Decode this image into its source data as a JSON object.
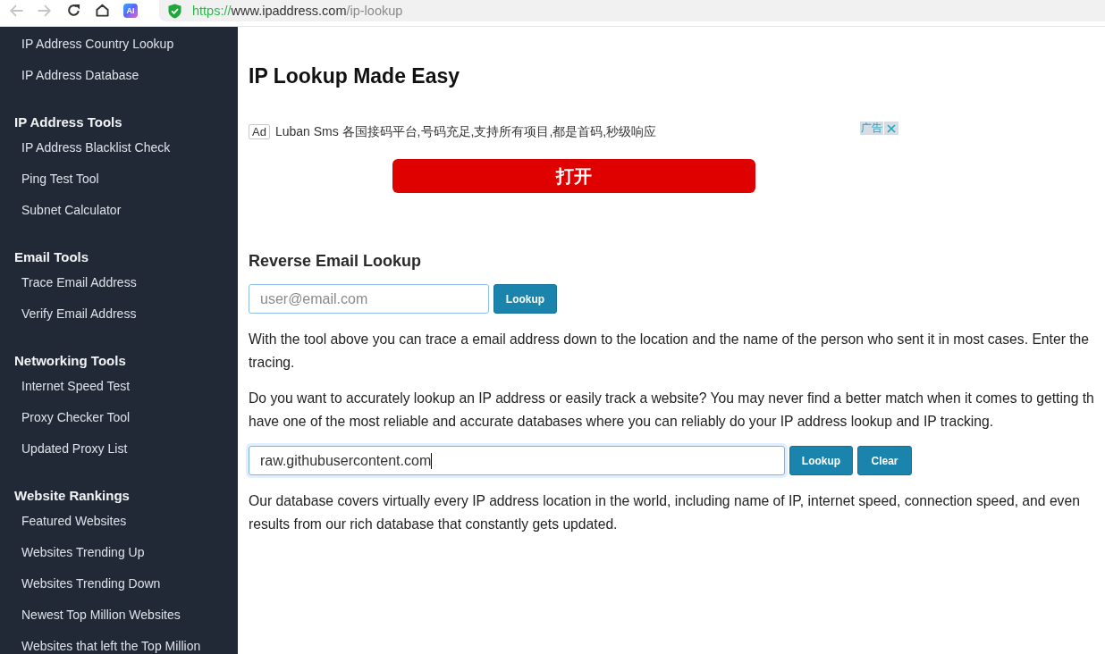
{
  "browser": {
    "nav_buttons": [
      {
        "kind": "back",
        "disabled": true
      },
      {
        "kind": "forward",
        "disabled": true
      },
      {
        "kind": "reload",
        "disabled": false
      },
      {
        "kind": "home",
        "disabled": false
      }
    ],
    "extension": {
      "label": "AI"
    },
    "address_bar": {
      "scheme": "https://",
      "host": "www.ipaddress.com",
      "path": "/ip-lookup"
    }
  },
  "sidebar": {
    "sections": [
      {
        "items": [
          "IP Address Country Lookup",
          "IP Address Database"
        ]
      },
      {
        "heading": "IP Address Tools",
        "items": [
          "IP Address Blacklist Check",
          "Ping Test Tool",
          "Subnet Calculator"
        ]
      },
      {
        "heading": "Email Tools",
        "items": [
          "Trace Email Address",
          "Verify Email Address"
        ]
      },
      {
        "heading": "Networking Tools",
        "items": [
          "Internet Speed Test",
          "Proxy Checker Tool",
          "Updated Proxy List"
        ]
      },
      {
        "heading": "Website Rankings",
        "items": [
          "Featured Websites",
          "Websites Trending Up",
          "Websites Trending Down",
          "Newest Top Million Websites",
          "Websites that left the Top Million"
        ]
      }
    ]
  },
  "main": {
    "title": "IP Lookup Made Easy",
    "ad": {
      "badge": "Ad",
      "text": "Luban Sms 各国接码平台,号码充足,支持所有项目,都是首码,秒级响应",
      "label": "广告",
      "button": "打开"
    },
    "email_lookup": {
      "heading": "Reverse Email Lookup",
      "input": {
        "placeholder": "user@email.com"
      },
      "button": "Lookup"
    },
    "description_paragraphs": [
      {
        "lines": [
          "With the tool above you can trace a email address down to the location and the name of the person who sent it in most cases. Enter the",
          "tracing."
        ]
      },
      {
        "lines": [
          "Do you want to accurately lookup an IP address or easily track a website? You may never find a better match when it comes to getting th",
          "have one of the most reliable and accurate databases where you can reliably do your IP address lookup and IP tracking."
        ]
      }
    ],
    "ip_lookup": {
      "input": {
        "value": "raw.githubusercontent.com",
        "focused": true
      },
      "buttons": [
        "Lookup",
        "Clear"
      ]
    },
    "closing_paragraph": {
      "lines": [
        "Our database covers virtually every IP address location in the world, including name of IP, internet speed, connection speed, and even",
        "results from our rich database that constantly gets updated."
      ]
    }
  }
}
